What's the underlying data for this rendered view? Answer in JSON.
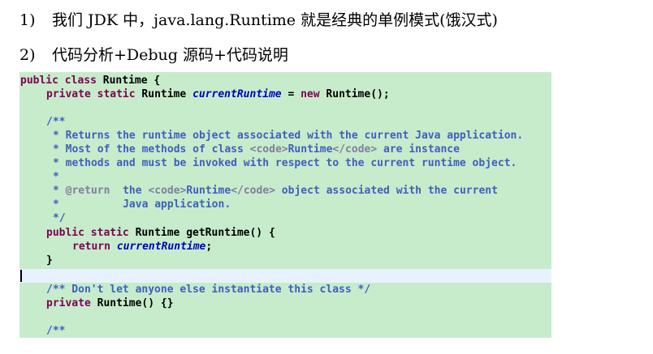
{
  "items": [
    {
      "number": "1)",
      "text": "我们 JDK 中，java.lang.Runtime 就是经典的单例模式(饿汉式)"
    },
    {
      "number": "2)",
      "text": "代码分析+Debug 源码+代码说明"
    }
  ],
  "code": {
    "l1": {
      "k1": "public",
      "k2": "class",
      "t1": "Runtime {"
    },
    "l2": {
      "k1": "private",
      "k2": "static",
      "t1": "Runtime",
      "field": "currentRuntime",
      "t2": "=",
      "k3": "new",
      "t3": "Runtime();"
    },
    "l4": "/**",
    "l5": "* Returns the runtime object associated with the current Java application.",
    "l6": {
      "a": "* Most of the methods of class ",
      "tag_open": "<code>",
      "b": "Runtime",
      "tag_close": "</code>",
      "c": " are instance"
    },
    "l7": "* methods and must be invoked with respect to the current runtime object.",
    "l8": "*",
    "l9": {
      "star": "* ",
      "tag_return": "@return",
      "a": "  the ",
      "tag_open": "<code>",
      "b": "Runtime",
      "tag_close": "</code>",
      "c": " object associated with the current"
    },
    "l10": "*          Java application.",
    "l11": "*/",
    "l12": {
      "k1": "public",
      "k2": "static",
      "t1": "Runtime getRuntime() {"
    },
    "l13": {
      "k1": "return",
      "field": "currentRuntime",
      "t1": ";"
    },
    "l14": "}",
    "l16": "/** Don't let anyone else instantiate this class */",
    "l17": {
      "k1": "private",
      "t1": "Runtime() {}"
    },
    "l19": "/**"
  },
  "colors": {
    "code_background": "#c7eccb",
    "keyword": "#7f0055",
    "field": "#0000c0",
    "comment": "#3f5fbf",
    "current_line": "#e8f2fe"
  }
}
